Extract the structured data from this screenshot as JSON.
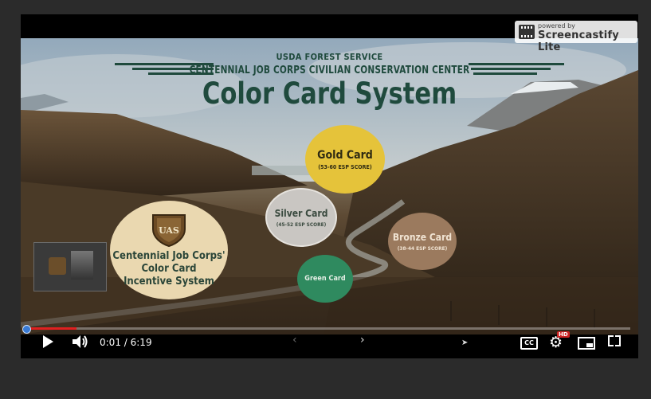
{
  "watermark": {
    "powered_by": "powered by",
    "brand": "Screencastify Lite",
    "icon": "film-strip-icon"
  },
  "slide": {
    "agency": "USDA FOREST SERVICE",
    "center_name": "CENTENNIAL JOB CORPS CIVILIAN CONSERVATION CENTER",
    "title": "Color Card System",
    "gold": {
      "title": "Gold Card",
      "sub": "(53-60 ESP SCORE)"
    },
    "silver": {
      "title": "Silver Card",
      "sub": "(45-52 ESP SCORE)"
    },
    "bronze": {
      "title": "Bronze Card",
      "sub": "(38-44 ESP SCORE)"
    },
    "green": {
      "title": "Green Card"
    },
    "cjc": {
      "line1": "Centennial Job Corps'",
      "line2": "Color Card",
      "line3": "Incentive System"
    },
    "shield_text": "UAS",
    "colors": {
      "gold": "#e5c33a",
      "silver": "#c9c6c2",
      "bronze": "#9b7a5e",
      "green": "#2f8a5f",
      "cjc": "#ead8b0",
      "title": "#1f4a3d"
    }
  },
  "player": {
    "current_time": "0:01",
    "separator": " / ",
    "duration": "6:19",
    "progress_fraction": 0.003,
    "hd_label": "HD",
    "cc_label": "CC",
    "icons": [
      "play-icon",
      "volume-icon",
      "prev-slide-icon",
      "next-slide-icon",
      "cc-icon",
      "settings-gear-icon",
      "miniplayer-icon",
      "fullscreen-icon"
    ],
    "accent": "#e02020"
  }
}
